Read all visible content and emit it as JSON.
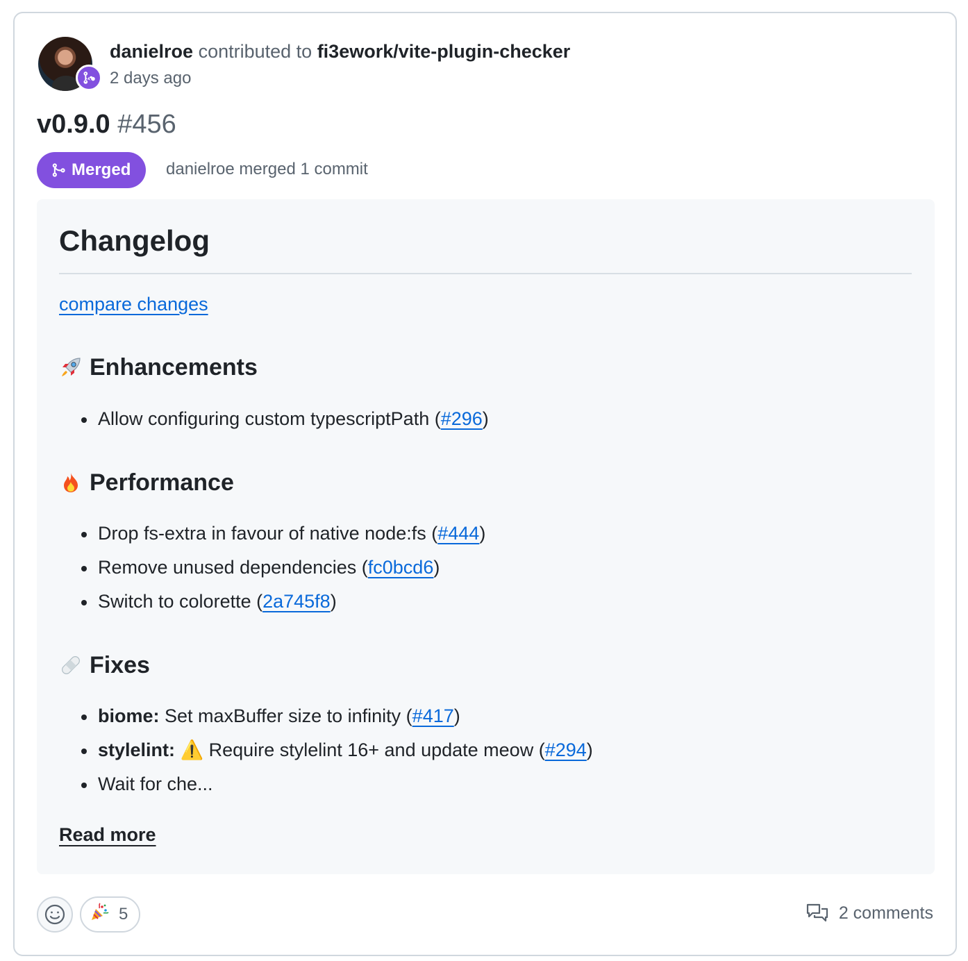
{
  "header": {
    "author": "danielroe",
    "contributed_text": "contributed to",
    "repo": "fi3ework/vite-plugin-checker",
    "timestamp": "2 days ago"
  },
  "pr": {
    "title": "v0.9.0",
    "number": "#456",
    "state": "Merged",
    "merge_info": "danielroe merged 1 commit"
  },
  "body": {
    "heading": "Changelog",
    "compare_link": "compare changes",
    "sections": [
      {
        "icon": "rocket-icon",
        "title": "Enhancements",
        "items": [
          {
            "prefix": "",
            "text": "Allow configuring custom typescriptPath (",
            "link": "#296",
            "suffix": ")"
          }
        ]
      },
      {
        "icon": "fire-icon",
        "title": "Performance",
        "items": [
          {
            "prefix": "",
            "text": "Drop fs-extra in favour of native node:fs (",
            "link": "#444",
            "suffix": ")"
          },
          {
            "prefix": "",
            "text": "Remove unused dependencies (",
            "link": "fc0bcd6",
            "suffix": ")"
          },
          {
            "prefix": "",
            "text": "Switch to colorette (",
            "link": "2a745f8",
            "suffix": ")"
          }
        ]
      },
      {
        "icon": "bandage-icon",
        "title": "Fixes",
        "items": [
          {
            "prefix": "biome:",
            "text": " Set maxBuffer size to infinity (",
            "link": "#417",
            "suffix": ")"
          },
          {
            "prefix": "stylelint:",
            "text": " ⚠️ Require stylelint 16+ and update meow (",
            "link": "#294",
            "suffix": ")"
          },
          {
            "prefix": "",
            "text": "Wait for che...",
            "link": "",
            "suffix": ""
          }
        ]
      }
    ],
    "read_more": "Read more"
  },
  "footer": {
    "reaction_emoji": "🎉",
    "reaction_count": "5",
    "comments": "2 comments"
  },
  "colors": {
    "merged_purple": "#8250df",
    "link_blue": "#0969da",
    "muted_text": "#59636e",
    "border": "#d0d7de",
    "body_bg": "#f6f8fa"
  }
}
